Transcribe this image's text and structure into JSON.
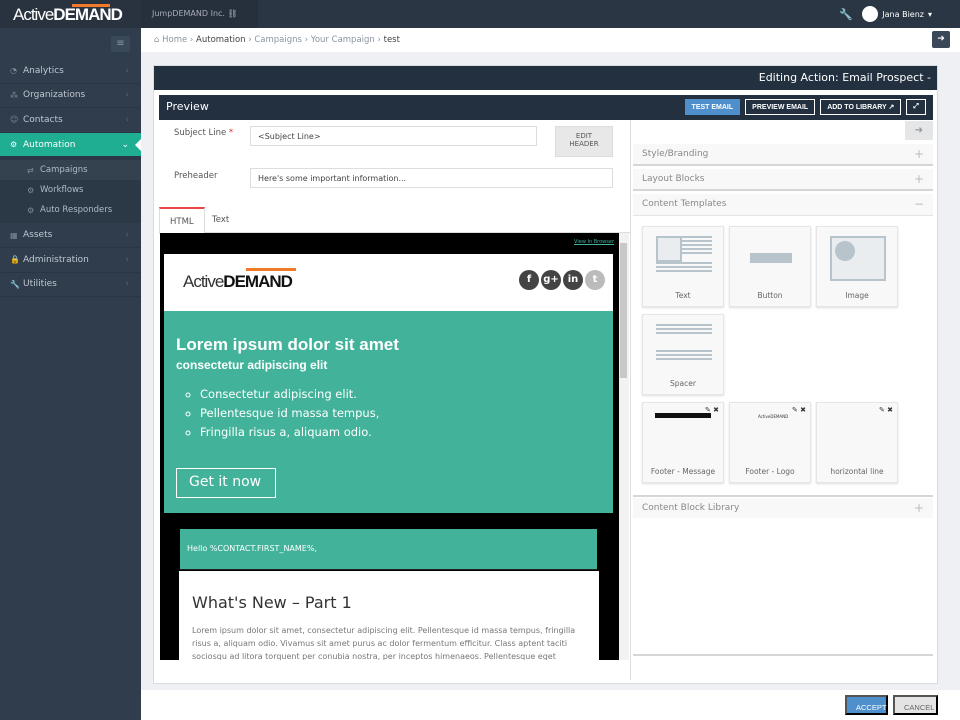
{
  "app": {
    "logo_light": "Active",
    "logo_bold": "DEMAND",
    "company": "JumpDEMAND Inc.",
    "user": "Jana Bienz"
  },
  "colors": {
    "accent": "#1fae92",
    "sidebar": "#2f3d4c",
    "primary_button": "#4f8fcc",
    "email_teal": "#42b39a"
  },
  "sidebar": {
    "items": [
      {
        "label": "Analytics",
        "icon": "dashboard-icon"
      },
      {
        "label": "Organizations",
        "icon": "sitemap-icon"
      },
      {
        "label": "Contacts",
        "icon": "users-icon"
      },
      {
        "label": "Automation",
        "icon": "cogs-icon",
        "active": true
      },
      {
        "label": "Assets",
        "icon": "grid-icon"
      },
      {
        "label": "Administration",
        "icon": "lock-icon"
      },
      {
        "label": "Utilities",
        "icon": "wrench-icon"
      }
    ],
    "sub_items": [
      {
        "label": "Campaigns",
        "selected": true
      },
      {
        "label": "Workflows"
      },
      {
        "label": "Auto Responders"
      }
    ]
  },
  "breadcrumb": [
    "Home",
    "Automation",
    "Campaigns",
    "Your Campaign",
    "test"
  ],
  "panel": {
    "title": "Editing Action: Email Prospect -"
  },
  "preview": {
    "title": "Preview",
    "test_email": "TEST EMAIL",
    "preview_email": "PREVIEW EMAIL",
    "add_to_library": "ADD TO LIBRARY"
  },
  "form": {
    "subject_label": "Subject Line",
    "required": "*",
    "subject_value": "<Subject Line>",
    "preheader_label": "Preheader",
    "preheader_value": "Here's some important information...",
    "edit_header_1": "EDIT",
    "edit_header_2": "HEADER"
  },
  "tabs": [
    {
      "label": "HTML",
      "active": true
    },
    {
      "label": "Text"
    }
  ],
  "email": {
    "view_in_browser": "View In Browser",
    "hero_title": "Lorem ipsum dolor sit amet",
    "hero_subtitle": "consectetur adipiscing elit",
    "bullets": [
      "Consectetur adipiscing elit.",
      "Pellentesque id massa tempus,",
      "Fringilla risus a, aliquam odio."
    ],
    "cta": "Get it now",
    "hello": "Hello %CONTACT.FIRST_NAME%,",
    "section_title": "What's New – Part 1",
    "body": "Lorem ipsum dolor sit amet, consectetur adipiscing elit. Pellentesque id massa tempus, fringilla risus a, aliquam odio. Vivamus sit amet purus ac dolor fermentum efficitur. Class aptent taciti sociosqu ad litora torquent per conubia nostra, per inceptos himenaeos. Pellentesque eget"
  },
  "right": {
    "sections": [
      "Style/Branding",
      "Layout Blocks",
      "Content Templates",
      "Content Block Library"
    ],
    "templates": [
      "Text",
      "Button",
      "Image",
      "Spacer"
    ],
    "saved_blocks": [
      "Footer - Message",
      "Footer - Logo",
      "horizontal line"
    ]
  },
  "footer": {
    "accept": "ACCEPT",
    "cancel": "CANCEL"
  }
}
